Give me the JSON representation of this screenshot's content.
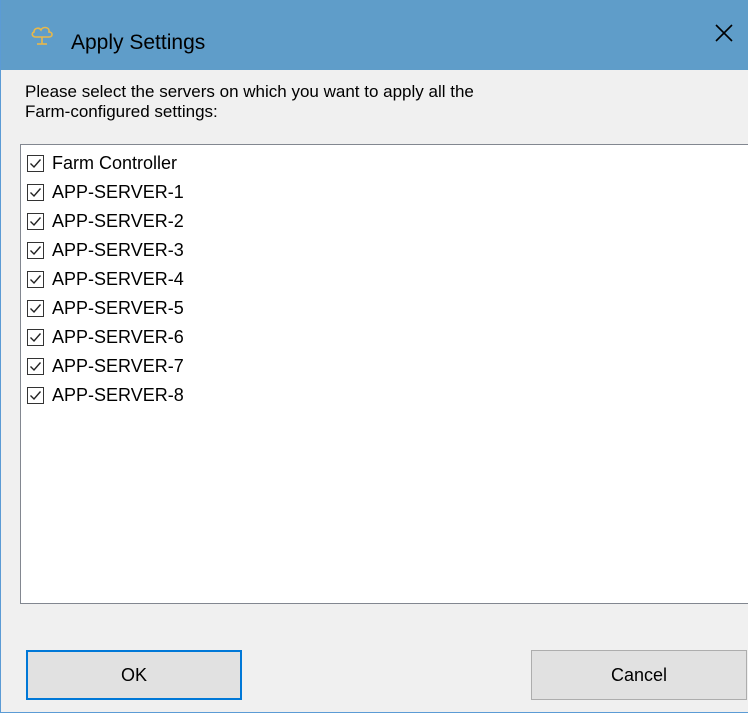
{
  "window": {
    "title": "Apply Settings",
    "app_icon": "cloud-server-icon",
    "close_icon": "close-icon"
  },
  "instructions": "Please select the servers on which you want to apply all the\nFarm-configured settings:",
  "servers": [
    {
      "label": "Farm Controller",
      "checked": true
    },
    {
      "label": "APP-SERVER-1",
      "checked": true
    },
    {
      "label": "APP-SERVER-2",
      "checked": true
    },
    {
      "label": "APP-SERVER-3",
      "checked": true
    },
    {
      "label": "APP-SERVER-4",
      "checked": true
    },
    {
      "label": "APP-SERVER-5",
      "checked": true
    },
    {
      "label": "APP-SERVER-6",
      "checked": true
    },
    {
      "label": "APP-SERVER-7",
      "checked": true
    },
    {
      "label": "APP-SERVER-8",
      "checked": true
    }
  ],
  "buttons": {
    "ok_label": "OK",
    "cancel_label": "Cancel"
  },
  "colors": {
    "titlebar": "#5f9dc9",
    "focus_border": "#0078d7"
  }
}
